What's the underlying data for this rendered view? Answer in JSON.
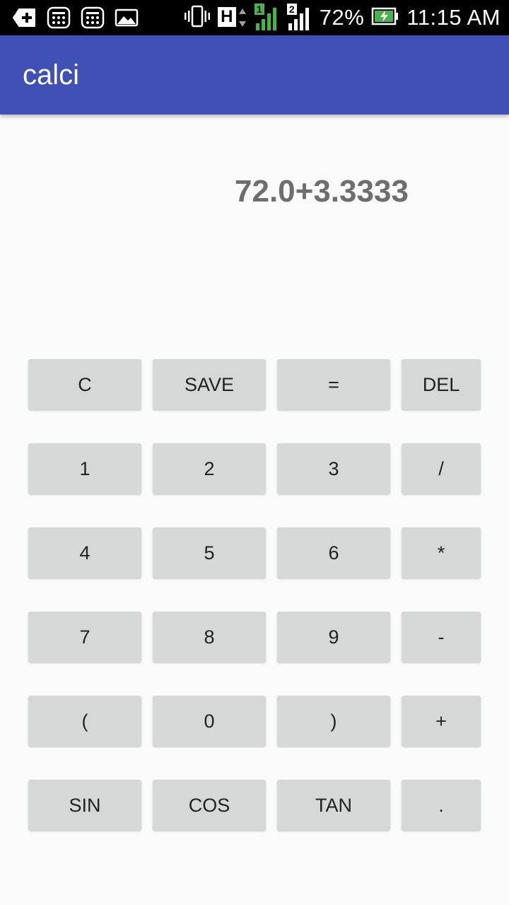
{
  "status_bar": {
    "icons_left": [
      "add-box-icon",
      "calculator-icon",
      "calculator-icon",
      "gallery-icon"
    ],
    "vibrate_icon": "vibrate-icon",
    "network_type": "H",
    "sim1_label": "1",
    "sim2_label": "2",
    "battery_percent": "72%",
    "time": "11:15 AM",
    "colors": {
      "signal_active": "#4caf50",
      "background": "#000000"
    }
  },
  "app_bar": {
    "title": "calci",
    "color": "#3f51b5"
  },
  "display": {
    "expression": "72.0+3.3333"
  },
  "keypad": {
    "rows": [
      [
        "C",
        "SAVE",
        "=",
        "DEL"
      ],
      [
        "1",
        "2",
        "3",
        "/"
      ],
      [
        "4",
        "5",
        "6",
        "*"
      ],
      [
        "7",
        "8",
        "9",
        "-"
      ],
      [
        "(",
        "0",
        ")",
        "+"
      ],
      [
        "SIN",
        "COS",
        "TAN",
        "."
      ]
    ]
  }
}
